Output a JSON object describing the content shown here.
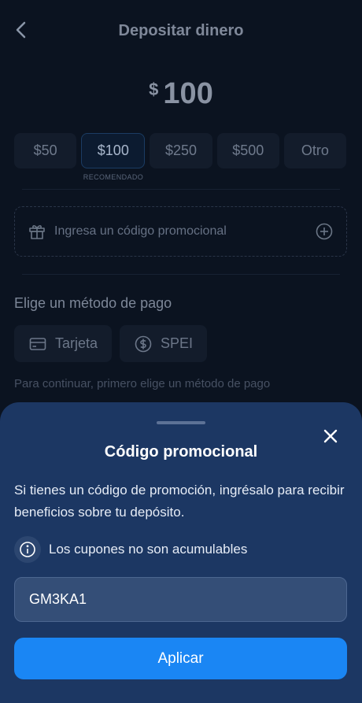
{
  "header": {
    "title": "Depositar dinero"
  },
  "amount": {
    "currency": "$",
    "value": "100"
  },
  "chips": [
    {
      "label": "$50"
    },
    {
      "label": "$100",
      "selected": true
    },
    {
      "label": "$250"
    },
    {
      "label": "$500"
    },
    {
      "label": "Otro"
    }
  ],
  "recommended_label": "RECOMENDADO",
  "promo": {
    "placeholder": "Ingresa un código promocional"
  },
  "payment": {
    "title": "Elige un método de pago",
    "methods": [
      {
        "label": "Tarjeta",
        "icon": "card-icon"
      },
      {
        "label": "SPEI",
        "icon": "dollar-icon"
      }
    ],
    "hint": "Para continuar, primero elige un método de pago"
  },
  "sheet": {
    "title": "Código promocional",
    "description": "Si tienes un código de promoción, ingrésalo para recibir beneficios sobre tu depósito.",
    "note": "Los cupones no son acumulables",
    "code_value": "GM3KA1",
    "apply_label": "Aplicar"
  },
  "colors": {
    "background": "#0b1320",
    "sheet": "#1c3763",
    "primary_button": "#1a86f4"
  }
}
